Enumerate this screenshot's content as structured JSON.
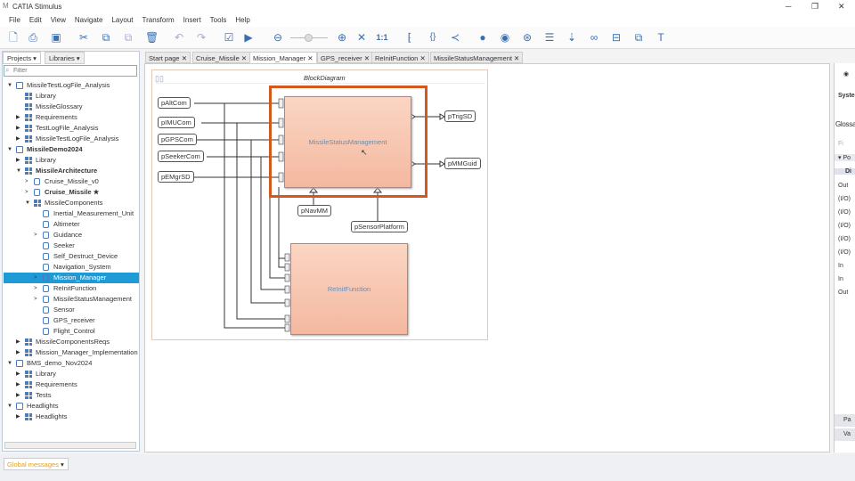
{
  "app": {
    "title": "CATIA Stimulus"
  },
  "menu": [
    "File",
    "Edit",
    "View",
    "Navigate",
    "Layout",
    "Transform",
    "Insert",
    "Tools",
    "Help"
  ],
  "toolbar": {
    "zoom_reset": "1:1"
  },
  "panel_tabs": [
    "Projects",
    "Libraries"
  ],
  "filter_placeholder": "Filter",
  "tree": [
    {
      "label": "MissileTestLogFile_Analysis",
      "level": 0,
      "icon": "proj",
      "arrow": "▼"
    },
    {
      "label": "Library",
      "level": 1,
      "icon": "grid",
      "arrow": ""
    },
    {
      "label": "MissileGlossary",
      "level": 1,
      "icon": "grid",
      "arrow": ""
    },
    {
      "label": "Requirements",
      "level": 1,
      "icon": "grid",
      "arrow": "▶"
    },
    {
      "label": "TestLogFile_Analysis",
      "level": 1,
      "icon": "grid",
      "arrow": "▶"
    },
    {
      "label": "MissileTestLogFile_Analysis",
      "level": 1,
      "icon": "grid",
      "arrow": "▶"
    },
    {
      "label": "MissileDemo2024",
      "level": 0,
      "icon": "proj",
      "arrow": "▼",
      "bold": true
    },
    {
      "label": "Library",
      "level": 1,
      "icon": "grid",
      "arrow": "▶"
    },
    {
      "label": "MissileArchitecture",
      "level": 1,
      "icon": "grid",
      "arrow": "▼",
      "bold": true
    },
    {
      "label": "Cruise_Missile_v0",
      "level": 2,
      "icon": "comp",
      "arrow": ">"
    },
    {
      "label": "Cruise_Missile ★",
      "level": 2,
      "icon": "comp",
      "arrow": ">",
      "bold": true
    },
    {
      "label": "MissileComponents",
      "level": 2,
      "icon": "grid",
      "arrow": "▼"
    },
    {
      "label": "Inertial_Measurement_Unit",
      "level": 3,
      "icon": "comp",
      "arrow": ""
    },
    {
      "label": "Altimeter",
      "level": 3,
      "icon": "comp",
      "arrow": ""
    },
    {
      "label": "Guidance",
      "level": 3,
      "icon": "comp",
      "arrow": ">"
    },
    {
      "label": "Seeker",
      "level": 3,
      "icon": "comp",
      "arrow": ""
    },
    {
      "label": "Self_Destruct_Device",
      "level": 3,
      "icon": "comp",
      "arrow": ""
    },
    {
      "label": "Navigation_System",
      "level": 3,
      "icon": "comp",
      "arrow": ""
    },
    {
      "label": "Mission_Manager",
      "level": 3,
      "icon": "comp",
      "arrow": ">",
      "selected": true
    },
    {
      "label": "ReInitFunction",
      "level": 3,
      "icon": "comp",
      "arrow": ">"
    },
    {
      "label": "MissileStatusManagement",
      "level": 3,
      "icon": "comp",
      "arrow": ">"
    },
    {
      "label": "Sensor",
      "level": 3,
      "icon": "comp",
      "arrow": ""
    },
    {
      "label": "GPS_receiver",
      "level": 3,
      "icon": "comp",
      "arrow": ""
    },
    {
      "label": "Flight_Control",
      "level": 3,
      "icon": "comp",
      "arrow": ""
    },
    {
      "label": "MissileComponentsReqs",
      "level": 1,
      "icon": "grid",
      "arrow": "▶"
    },
    {
      "label": "Mission_Manager_Implementation",
      "level": 1,
      "icon": "grid",
      "arrow": "▶"
    },
    {
      "label": "BMS_demo_Nov2024",
      "level": 0,
      "icon": "proj",
      "arrow": "▼"
    },
    {
      "label": "Library",
      "level": 1,
      "icon": "grid",
      "arrow": "▶"
    },
    {
      "label": "Requirements",
      "level": 1,
      "icon": "grid",
      "arrow": "▶"
    },
    {
      "label": "Tests",
      "level": 1,
      "icon": "grid",
      "arrow": "▶"
    },
    {
      "label": "Headlights",
      "level": 0,
      "icon": "proj",
      "arrow": "▼"
    },
    {
      "label": "Headlights",
      "level": 1,
      "icon": "grid",
      "arrow": "▶"
    }
  ],
  "doc_tabs": [
    "Start page",
    "Cruise_Missile",
    "Mission_Manager",
    "GPS_receiver",
    "ReInitFunction",
    "MissileStatusManagement"
  ],
  "active_tab": "Mission_Manager",
  "diagram": {
    "title": "BlockDiagram",
    "inputs": [
      "pAltCom",
      "pIMUCom",
      "pGPSCom",
      "pSeekerCom",
      "pEMgrSD"
    ],
    "outputs": [
      "pTrigSD",
      "pMMGuid"
    ],
    "bottom_ports": [
      "pNavMM",
      "pSensorPlatform"
    ],
    "blocks": [
      "MissileStatusManagement",
      "ReInitFunction"
    ],
    "highlight_color": "#d4581e"
  },
  "right_panel": {
    "title": "Syste",
    "glossary": "Glossa",
    "filter": "Fi",
    "section": "Po",
    "column": "Di",
    "directions": [
      "Out",
      "(I/O)",
      "(I/O)",
      "(I/O)",
      "(I/O)",
      "(I/O)",
      "In",
      "In",
      "Out"
    ],
    "buttons": [
      "Pa",
      "Va"
    ]
  },
  "bottom": {
    "global_messages": "Global messages"
  }
}
